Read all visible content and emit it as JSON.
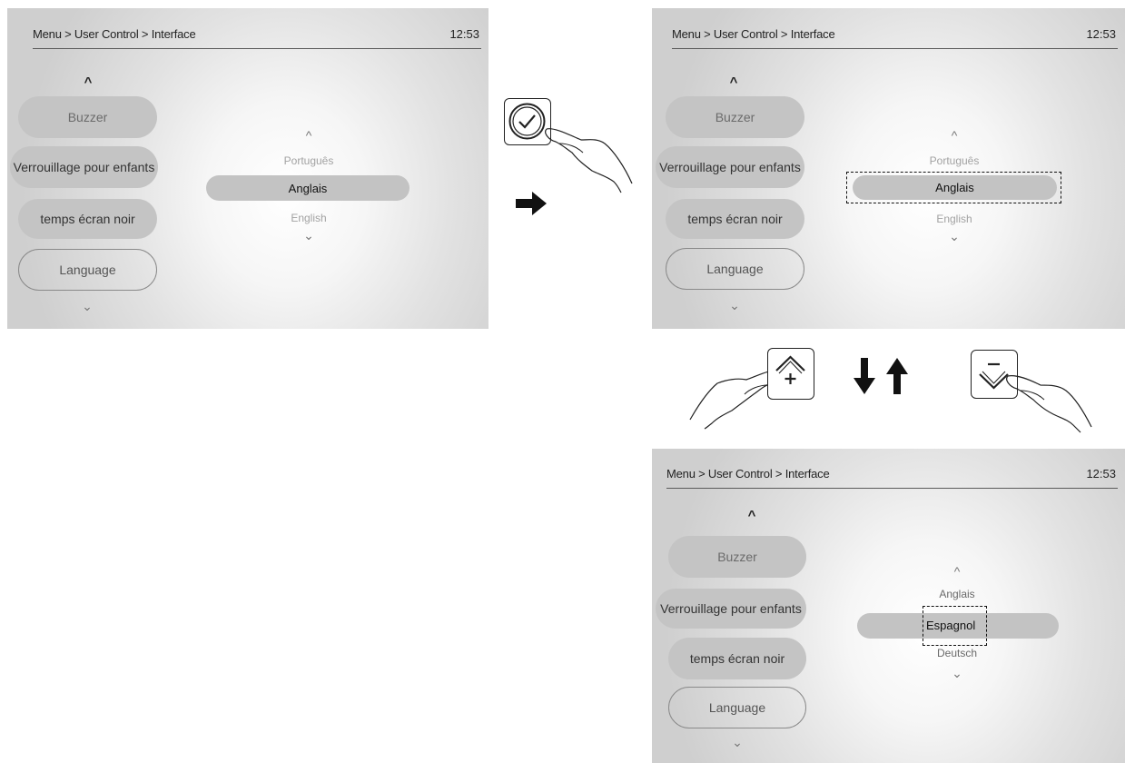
{
  "header": {
    "breadcrumb": "Menu > User Control > Interface",
    "time": "12:53"
  },
  "menu": {
    "buzzer": "Buzzer",
    "child_lock": "Verrouillage pour enfants",
    "black_screen_time": "temps écran noir",
    "language": "Language"
  },
  "screens": [
    {
      "name": "language-list",
      "above": "Português",
      "selected": "Anglais",
      "below": "English"
    },
    {
      "name": "language-confirmed",
      "above": "Português",
      "selected": "Anglais",
      "below": "English"
    },
    {
      "name": "language-scrolled",
      "above": "Anglais",
      "selected": "Espagnol",
      "below": "Deutsch"
    }
  ],
  "icons": {
    "confirm_key": "check-circle-icon",
    "up_key": "chevron-up-plus-icon",
    "down_key": "chevron-down-minus-icon",
    "next_step": "arrow-right-icon",
    "scroll_direction": "arrow-down-up-icon"
  }
}
